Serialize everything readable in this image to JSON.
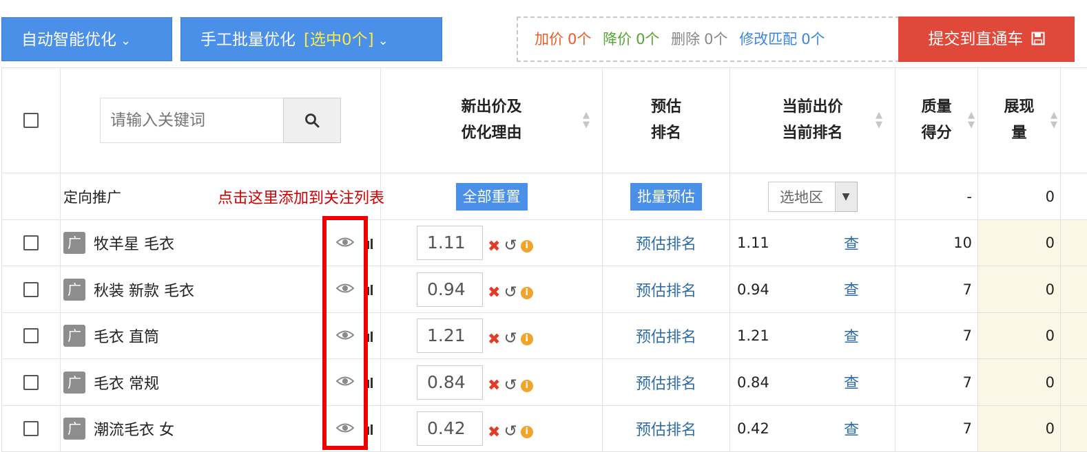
{
  "toolbar": {
    "auto_optimize_label": "自动智能优化",
    "manual_batch_label": "手工批量优化",
    "manual_selected": "[选中0个]",
    "stats": {
      "raise_label": "加价",
      "raise_count": "0个",
      "lower_label": "降价",
      "lower_count": "0个",
      "delete_label": "删除",
      "delete_count": "0个",
      "modify_label": "修改匹配",
      "modify_count": "0个"
    },
    "submit_label": "提交到直通车"
  },
  "search": {
    "placeholder": "请输入关键词"
  },
  "headers": {
    "new_bid_line1": "新出价及",
    "new_bid_line2": "优化理由",
    "est_line1": "预估",
    "est_line2": "排名",
    "cur_line1": "当前出价",
    "cur_line2": "当前排名",
    "quality_line1": "质量",
    "quality_line2": "得分",
    "impr_line1": "展现",
    "impr_line2": "量"
  },
  "summary_row": {
    "name": "定向推广",
    "annotation": "点击这里添加到关注列表",
    "reset_all": "全部重置",
    "batch_estimate": "批量预估",
    "region_placeholder": "选地区",
    "quality": "-",
    "impressions": "0"
  },
  "row_labels": {
    "badge": "广",
    "estimate_link": "预估排名",
    "check_link": "查"
  },
  "rows": [
    {
      "keyword": "牧羊星 毛衣",
      "bid": "1.11",
      "current_bid": "1.11",
      "quality": "10",
      "impressions": "0"
    },
    {
      "keyword": "秋装 新款 毛衣",
      "bid": "0.94",
      "current_bid": "0.94",
      "quality": "7",
      "impressions": "0"
    },
    {
      "keyword": "毛衣 直筒",
      "bid": "1.21",
      "current_bid": "1.21",
      "quality": "7",
      "impressions": "0"
    },
    {
      "keyword": "毛衣 常规",
      "bid": "0.84",
      "current_bid": "0.84",
      "quality": "7",
      "impressions": "0"
    },
    {
      "keyword": "潮流毛衣 女",
      "bid": "0.42",
      "current_bid": "0.42",
      "quality": "7",
      "impressions": "0"
    }
  ],
  "colors": {
    "primary_blue": "#4a90e8",
    "submit_red": "#e0483a",
    "annotation_red": "#ee0000"
  }
}
